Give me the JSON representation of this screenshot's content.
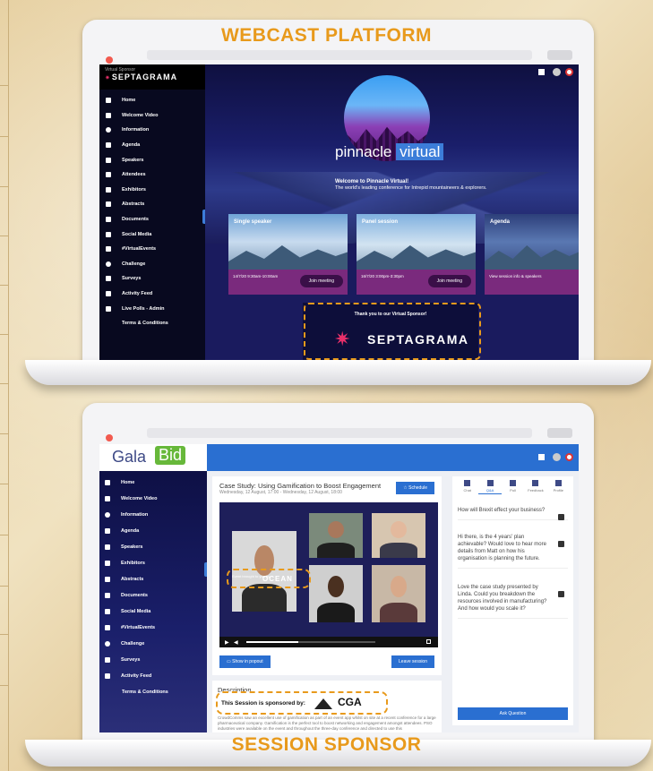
{
  "titles": {
    "top": "WEBCAST PLATFORM",
    "bottom": "SESSION SPONSOR"
  },
  "webcast": {
    "sponsor_header": {
      "label": "Virtual Sponsor",
      "brand": "SEPTAGRAMA"
    },
    "nav": [
      {
        "label": "Home",
        "icon": "home-icon"
      },
      {
        "label": "Welcome Video",
        "icon": "video-icon"
      },
      {
        "label": "Information",
        "icon": "info-icon"
      },
      {
        "label": "Agenda",
        "icon": "calendar-icon"
      },
      {
        "label": "Speakers",
        "icon": "microphone-icon"
      },
      {
        "label": "Attendees",
        "icon": "people-icon"
      },
      {
        "label": "Exhibitors",
        "icon": "flag-icon"
      },
      {
        "label": "Abstracts",
        "icon": "document-icon"
      },
      {
        "label": "Documents",
        "icon": "file-icon"
      },
      {
        "label": "Social Media",
        "icon": "grid-icon"
      },
      {
        "label": "#VirtualEvents",
        "icon": "twitter-icon"
      },
      {
        "label": "Challenge",
        "icon": "target-icon"
      },
      {
        "label": "Surveys",
        "icon": "chat-icon"
      },
      {
        "label": "Activity Feed",
        "icon": "share-icon"
      },
      {
        "label": "Live Polls - Admin",
        "icon": "poll-icon"
      },
      {
        "label": "Terms & Conditions",
        "icon": ""
      }
    ],
    "hero": {
      "logo_text": "pinnacle",
      "logo_highlight": "virtual",
      "welcome_title": "Welcome to Pinnacle Virtual!",
      "welcome_body": "The world's leading conference for Intrepid mountaineers & explorers."
    },
    "cards": [
      {
        "title": "Single speaker",
        "time": "14/7/20\n9:30am-10:00am",
        "button": "Join meeting"
      },
      {
        "title": "Panel session",
        "time": "16/7/20\n3:00pm-3:30pm",
        "button": "Join meeting"
      },
      {
        "title": "Agenda",
        "time": "View session info & speakers",
        "button": ""
      }
    ],
    "sponsor_box": {
      "thanks": "Thank you to our Virtual Sponsor!",
      "brand": "SEPTAGRAMA"
    }
  },
  "session": {
    "logo": {
      "gala": "Gala",
      "bid": "Bid"
    },
    "nav": [
      {
        "label": "Home"
      },
      {
        "label": "Welcome Video"
      },
      {
        "label": "Information"
      },
      {
        "label": "Agenda"
      },
      {
        "label": "Speakers"
      },
      {
        "label": "Exhibitors"
      },
      {
        "label": "Abstracts"
      },
      {
        "label": "Documents"
      },
      {
        "label": "Social Media"
      },
      {
        "label": "#VirtualEvents"
      },
      {
        "label": "Challenge"
      },
      {
        "label": "Surveys"
      },
      {
        "label": "Activity Feed"
      },
      {
        "label": "Terms & Conditions"
      }
    ],
    "case": {
      "title": "Case Study: Using Gamification to Boost Engagement",
      "subtitle": "Wednesday, 12 August, 17:00 - Wednesday, 12 August, 18:00",
      "schedule_button": "Schedule"
    },
    "video": {
      "brought_by": "Event brought to you by",
      "brand": "OCEAN"
    },
    "buttons": {
      "popout": "Show in popout",
      "leave": "Leave session"
    },
    "description": {
      "heading": "Description",
      "sponsored_label": "This Session is sponsored by:",
      "sponsor_brand": "CGA",
      "body": "CrowdComms saw an excellent use of gamification as part of an event app whilst on site at a recent conference for a large pharmaceutical company. Gamification is the perfect tool to boost networking and engagement amongst attendees.\nPSO industries were available on the event and throughout the three-day conference and directed to use this"
    },
    "qa": {
      "tabs": [
        "Chat",
        "Q&A",
        "Poll",
        "Feedback",
        "Profile"
      ],
      "questions": [
        "How will Brexit effect your business?",
        "Hi there, is the 4 years' plan achievable? Would love to hear more details from Matt on how his organisation is planning the future.",
        "Love the case study presented by Linda. Could you breakdown the resources involved in manufacturing? And how would you scale it?"
      ],
      "ask_button": "Ask Question"
    }
  }
}
